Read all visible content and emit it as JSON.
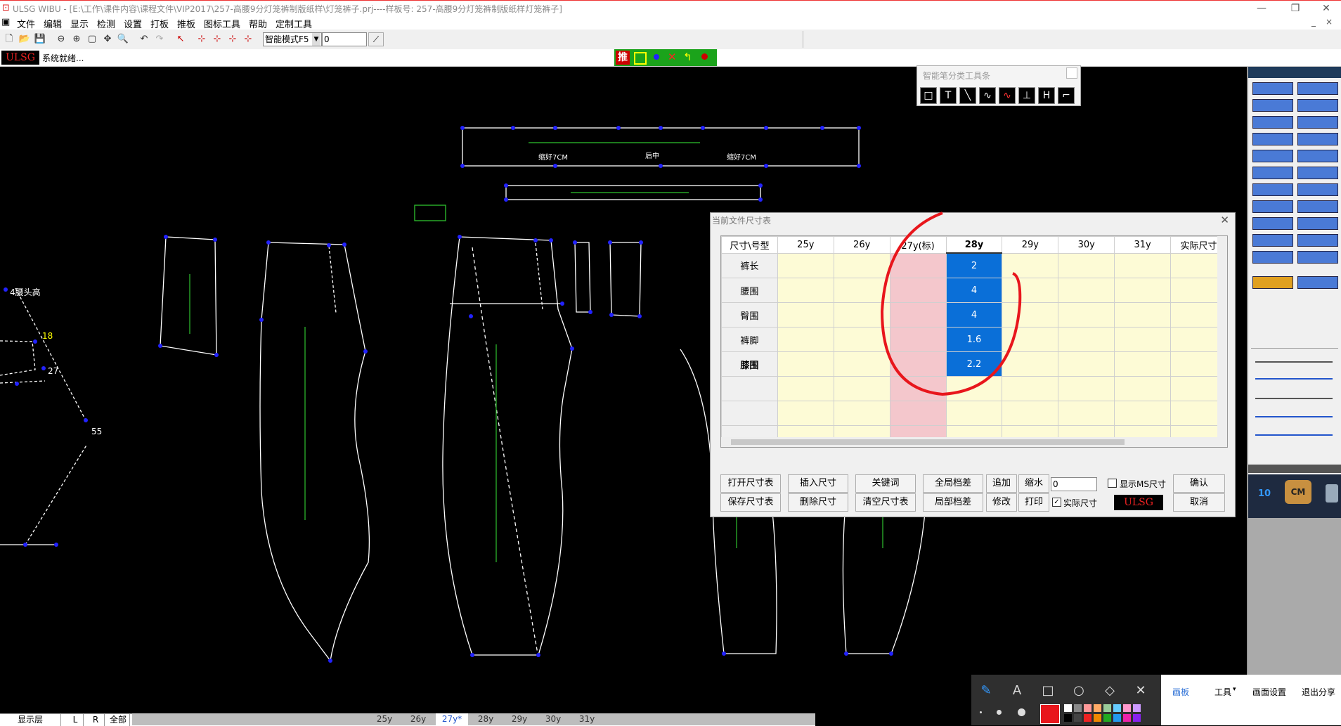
{
  "title": "ULSG WIBU - [E:\\工作\\课件内容\\课程文件\\VIP2017\\257-高腰9分灯笼裤制版纸样\\灯笼裤子.prj----样板号: 257-高腰9分灯笼裤制版纸样灯笼裤子]",
  "menu": [
    "文件",
    "编辑",
    "显示",
    "检测",
    "设置",
    "打板",
    "推板",
    "图标工具",
    "帮助",
    "定制工具"
  ],
  "toolbar": {
    "mode": "智能模式F5",
    "value": "0"
  },
  "status": {
    "brand": "ULSG",
    "text": "系统就绪...",
    "grade_icon": "推"
  },
  "smart_toolbar": {
    "title": "智能笔分类工具条",
    "tools": [
      "□",
      "T",
      "╲",
      "∿",
      "∿",
      "⊥",
      "H",
      "⌐"
    ]
  },
  "canvas_labels": {
    "waist_left": "缩好7CM",
    "waist_mid": "后中",
    "waist_right": "缩好7CM",
    "waist_head": "4腰头高",
    "n18": "18",
    "n27": "27",
    "n55": "55"
  },
  "dialog": {
    "title": "当前文件尺寸表",
    "columns": [
      "尺寸\\号型",
      "25y",
      "26y",
      "27y(标)",
      "28y",
      "29y",
      "30y",
      "31y",
      "实际尺寸"
    ],
    "rows": [
      {
        "label": "裤长",
        "v28": "2"
      },
      {
        "label": "腰围",
        "v28": "4"
      },
      {
        "label": "臀围",
        "v28": "4"
      },
      {
        "label": "裤脚",
        "v28": "1.6"
      },
      {
        "label": "膝围",
        "v28": "2.2"
      },
      {
        "label": ""
      },
      {
        "label": ""
      },
      {
        "label": ""
      }
    ],
    "buttons_row1": [
      "打开尺寸表",
      "插入尺寸",
      "关键词",
      "全局档差",
      "追加",
      "缩水"
    ],
    "buttons_row2": [
      "保存尺寸表",
      "删除尺寸",
      "清空尺寸表",
      "局部档差",
      "修改",
      "打印"
    ],
    "shrink_value": "0",
    "show_ms": "显示MS尺寸",
    "actual": "实际尺寸",
    "ok": "确认",
    "cancel": "取消",
    "brand": "ULSG"
  },
  "bottom": {
    "layer": "显示层",
    "l": "L",
    "r": "R",
    "all": "全部",
    "sizes": [
      "25y",
      "26y",
      "27y*",
      "28y",
      "29y",
      "30y",
      "31y"
    ]
  },
  "right_panel": {
    "num": "10",
    "cm": "CM"
  },
  "annotation_menu": [
    "画板",
    "工具",
    "画面设置",
    "退出分享"
  ],
  "colors": {
    "accent_blue": "#0a6fd8",
    "pink_column": "#f4c7cc",
    "cell_yellow": "#fdfbd6",
    "annotation_red": "#e8161c"
  }
}
